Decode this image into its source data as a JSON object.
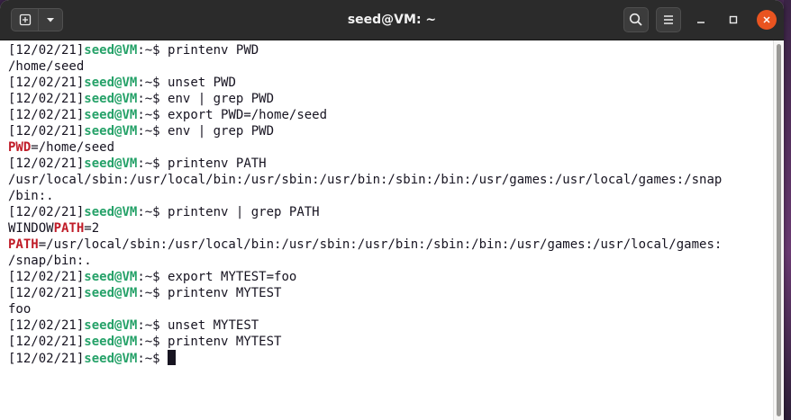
{
  "window": {
    "title": "seed@VM: ~"
  },
  "titlebar_buttons": {
    "new_tab_icon": "new-tab-icon",
    "menu_icon": "chevron-down-icon",
    "search_icon": "search-icon",
    "hamburger_icon": "hamburger-menu-icon",
    "minimize_icon": "minimize-icon",
    "maximize_icon": "maximize-icon",
    "close_icon": "close-icon"
  },
  "colors": {
    "titlebar": "#2b2b2b",
    "terminal_bg": "#ffffff",
    "prompt_user_host": "#26a269",
    "match_highlight": "#c01c28",
    "close_button": "#e95420"
  },
  "terminal": {
    "lines": [
      {
        "type": "prompt",
        "date": "[12/02/21]",
        "user": "seed@VM",
        "path": ":~$ ",
        "cmd": "printenv PWD"
      },
      {
        "type": "out",
        "text": "/home/seed"
      },
      {
        "type": "prompt",
        "date": "[12/02/21]",
        "user": "seed@VM",
        "path": ":~$ ",
        "cmd": "unset PWD"
      },
      {
        "type": "prompt",
        "date": "[12/02/21]",
        "user": "seed@VM",
        "path": ":~$ ",
        "cmd": "env | grep PWD"
      },
      {
        "type": "prompt",
        "date": "[12/02/21]",
        "user": "seed@VM",
        "path": ":~$ ",
        "cmd": "export PWD=/home/seed"
      },
      {
        "type": "prompt",
        "date": "[12/02/21]",
        "user": "seed@VM",
        "path": ":~$ ",
        "cmd": "env | grep PWD"
      },
      {
        "type": "match",
        "pre": "",
        "hl": "PWD",
        "post": "=/home/seed"
      },
      {
        "type": "prompt",
        "date": "[12/02/21]",
        "user": "seed@VM",
        "path": ":~$ ",
        "cmd": "printenv PATH"
      },
      {
        "type": "out",
        "text": "/usr/local/sbin:/usr/local/bin:/usr/sbin:/usr/bin:/sbin:/bin:/usr/games:/usr/local/games:/snap"
      },
      {
        "type": "out",
        "text": "/bin:."
      },
      {
        "type": "prompt",
        "date": "[12/02/21]",
        "user": "seed@VM",
        "path": ":~$ ",
        "cmd": "printenv | grep PATH"
      },
      {
        "type": "match",
        "pre": "WINDOW",
        "hl": "PATH",
        "post": "=2"
      },
      {
        "type": "match",
        "pre": "",
        "hl": "PATH",
        "post": "=/usr/local/sbin:/usr/local/bin:/usr/sbin:/usr/bin:/sbin:/bin:/usr/games:/usr/local/games:"
      },
      {
        "type": "out",
        "text": "/snap/bin:."
      },
      {
        "type": "prompt",
        "date": "[12/02/21]",
        "user": "seed@VM",
        "path": ":~$ ",
        "cmd": "export MYTEST=foo"
      },
      {
        "type": "prompt",
        "date": "[12/02/21]",
        "user": "seed@VM",
        "path": ":~$ ",
        "cmd": "printenv MYTEST"
      },
      {
        "type": "out",
        "text": "foo"
      },
      {
        "type": "prompt",
        "date": "[12/02/21]",
        "user": "seed@VM",
        "path": ":~$ ",
        "cmd": "unset MYTEST"
      },
      {
        "type": "prompt",
        "date": "[12/02/21]",
        "user": "seed@VM",
        "path": ":~$ ",
        "cmd": "printenv MYTEST"
      },
      {
        "type": "prompt",
        "date": "[12/02/21]",
        "user": "seed@VM",
        "path": ":~$ ",
        "cmd": "",
        "cursor": true
      }
    ]
  }
}
